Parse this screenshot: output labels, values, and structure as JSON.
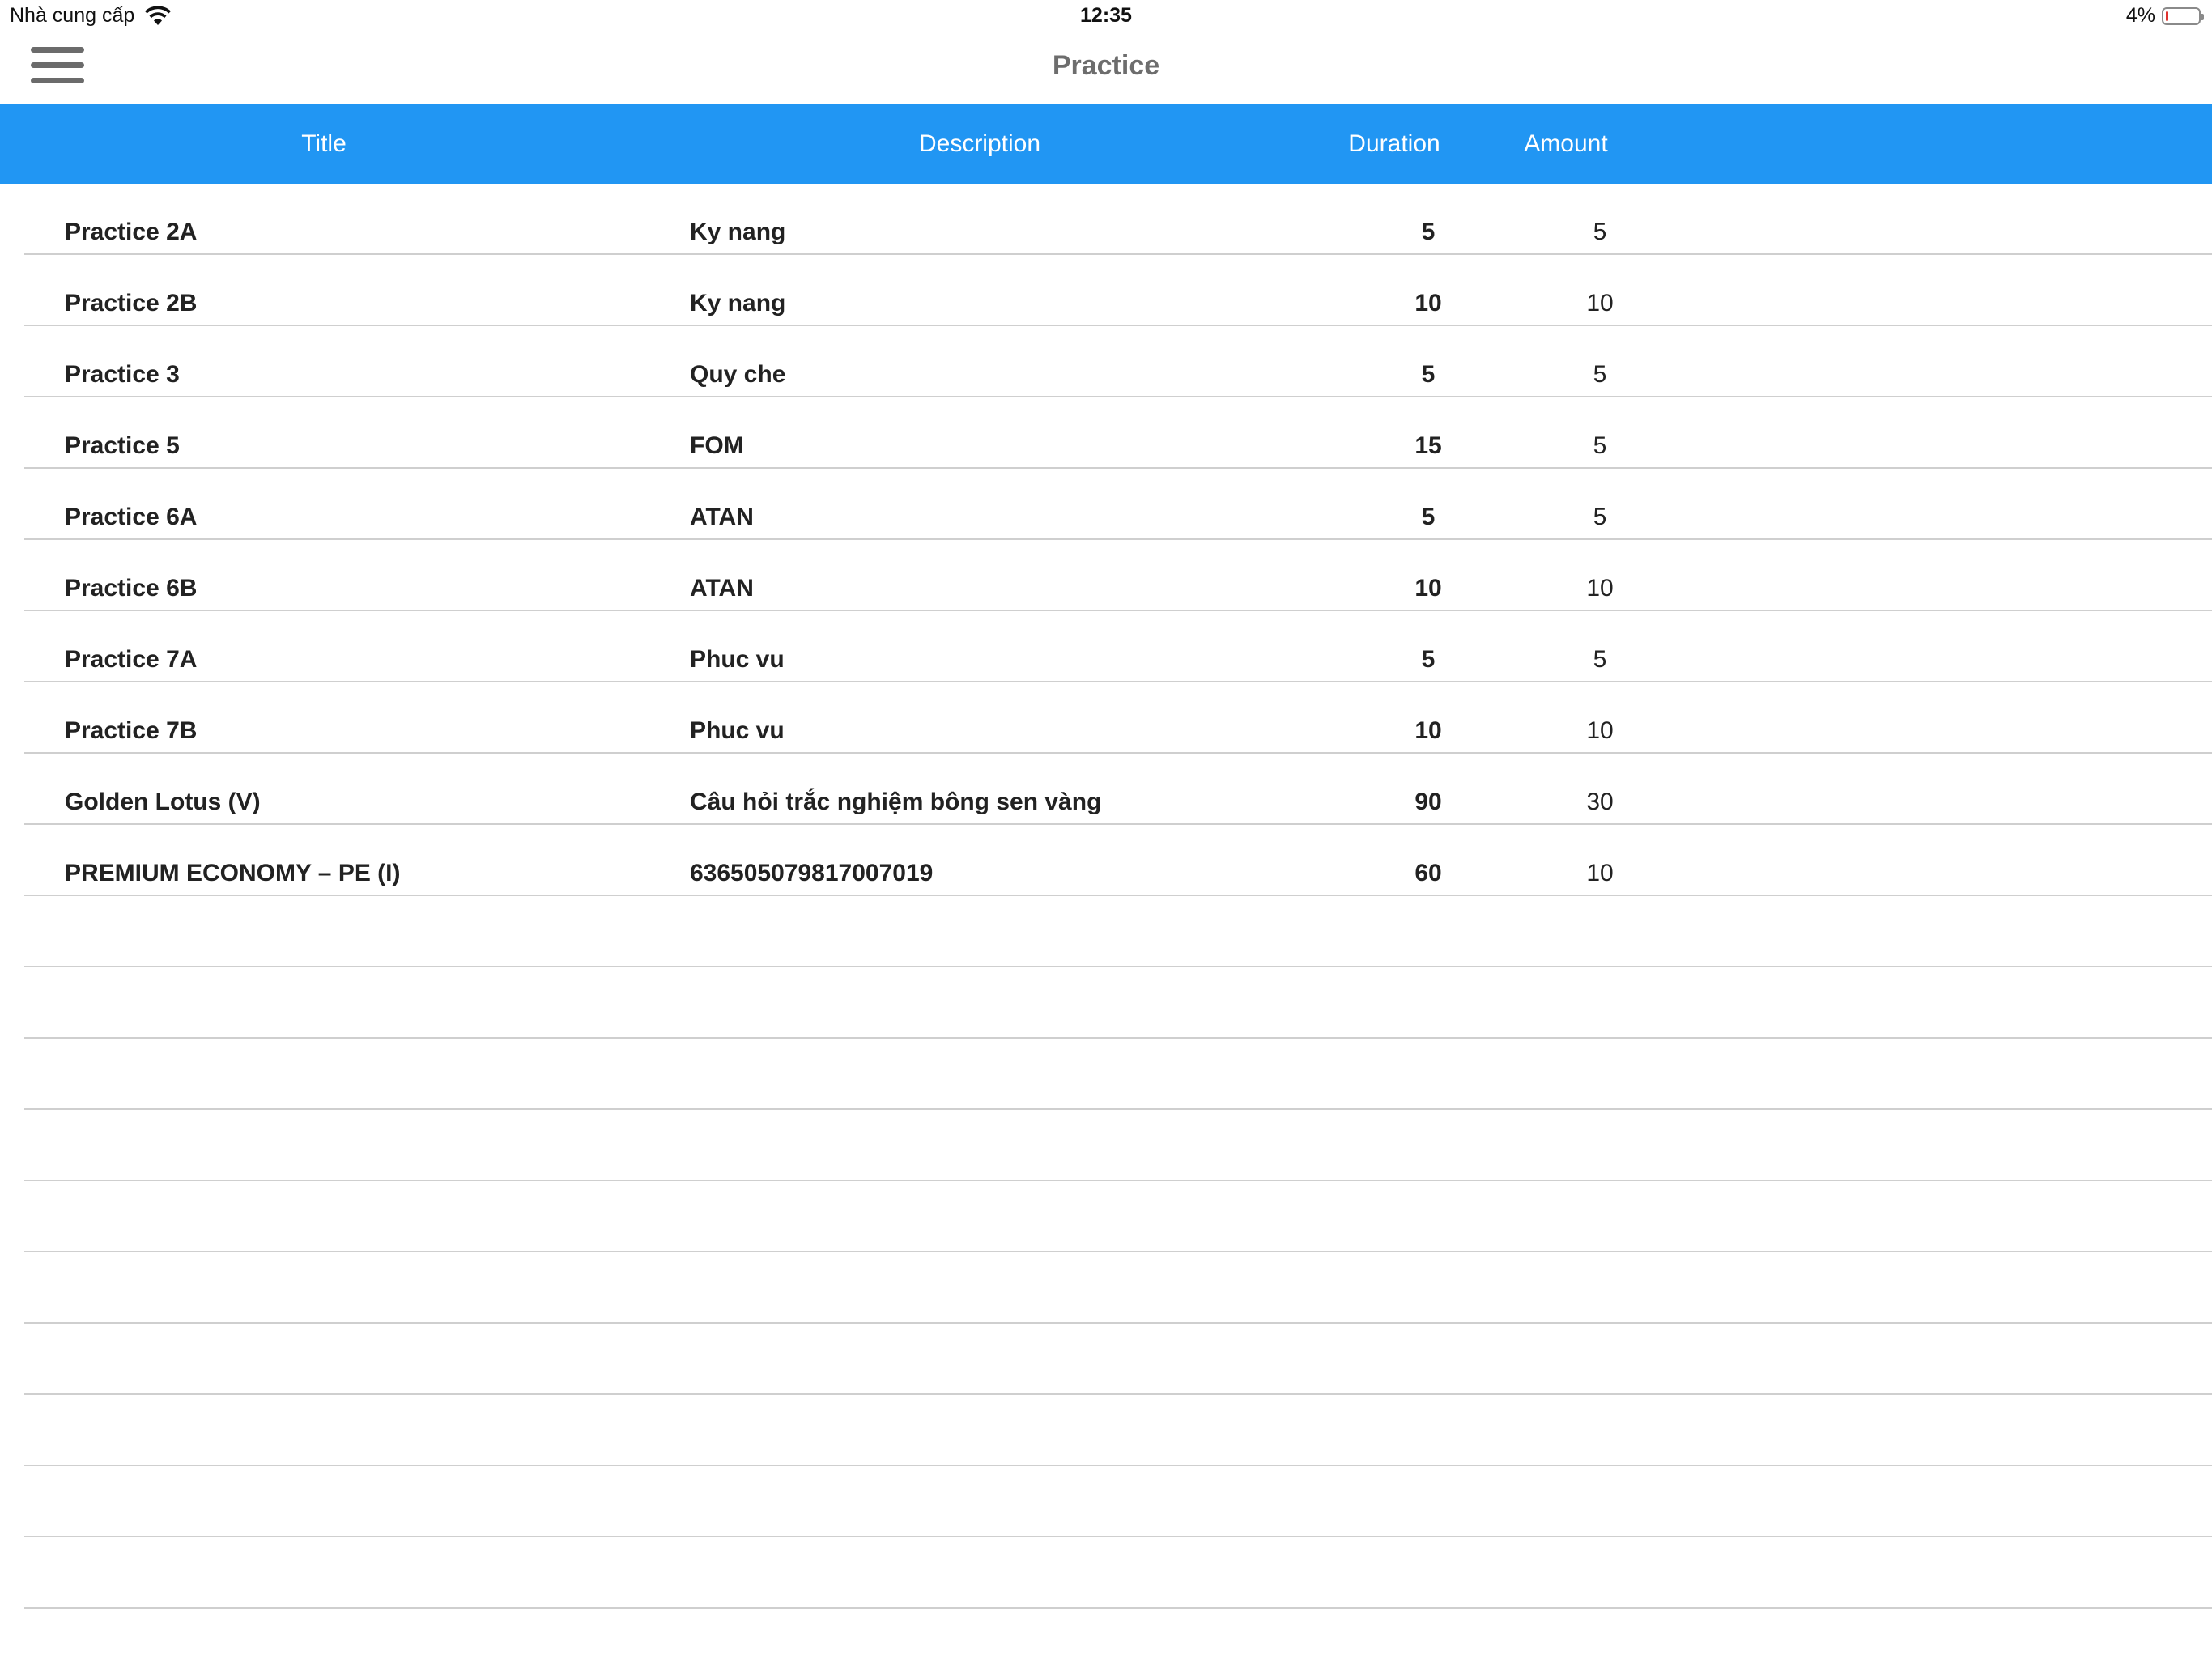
{
  "status_bar": {
    "carrier": "Nhà cung cấp",
    "time": "12:35",
    "battery_text": "4%",
    "battery_level": 0.04,
    "battery_color": "#e0332f"
  },
  "nav": {
    "title": "Practice",
    "menu_icon": "hamburger-menu-icon"
  },
  "table": {
    "header_color": "#2196f3",
    "columns": [
      "Title",
      "Description",
      "Duration",
      "Amount"
    ],
    "rows": [
      {
        "title": "Practice 2A",
        "description": "Ky nang",
        "duration": "5",
        "amount": "5"
      },
      {
        "title": "Practice 2B",
        "description": "Ky nang",
        "duration": "10",
        "amount": "10"
      },
      {
        "title": "Practice 3",
        "description": "Quy che",
        "duration": "5",
        "amount": "5"
      },
      {
        "title": "Practice 5",
        "description": "FOM",
        "duration": "15",
        "amount": "5"
      },
      {
        "title": "Practice 6A",
        "description": "ATAN",
        "duration": "5",
        "amount": "5"
      },
      {
        "title": "Practice 6B",
        "description": "ATAN",
        "duration": "10",
        "amount": "10"
      },
      {
        "title": "Practice 7A",
        "description": "Phuc vu",
        "duration": "5",
        "amount": "5"
      },
      {
        "title": "Practice 7B",
        "description": "Phuc vu",
        "duration": "10",
        "amount": "10"
      },
      {
        "title": "Golden Lotus (V)",
        "description": "Câu hỏi trắc nghiệm bông sen vàng",
        "duration": "90",
        "amount": "30"
      },
      {
        "title": "PREMIUM ECONOMY – PE (I)",
        "description": "636505079817007019",
        "duration": "60",
        "amount": "10"
      }
    ],
    "empty_rows": 10
  }
}
